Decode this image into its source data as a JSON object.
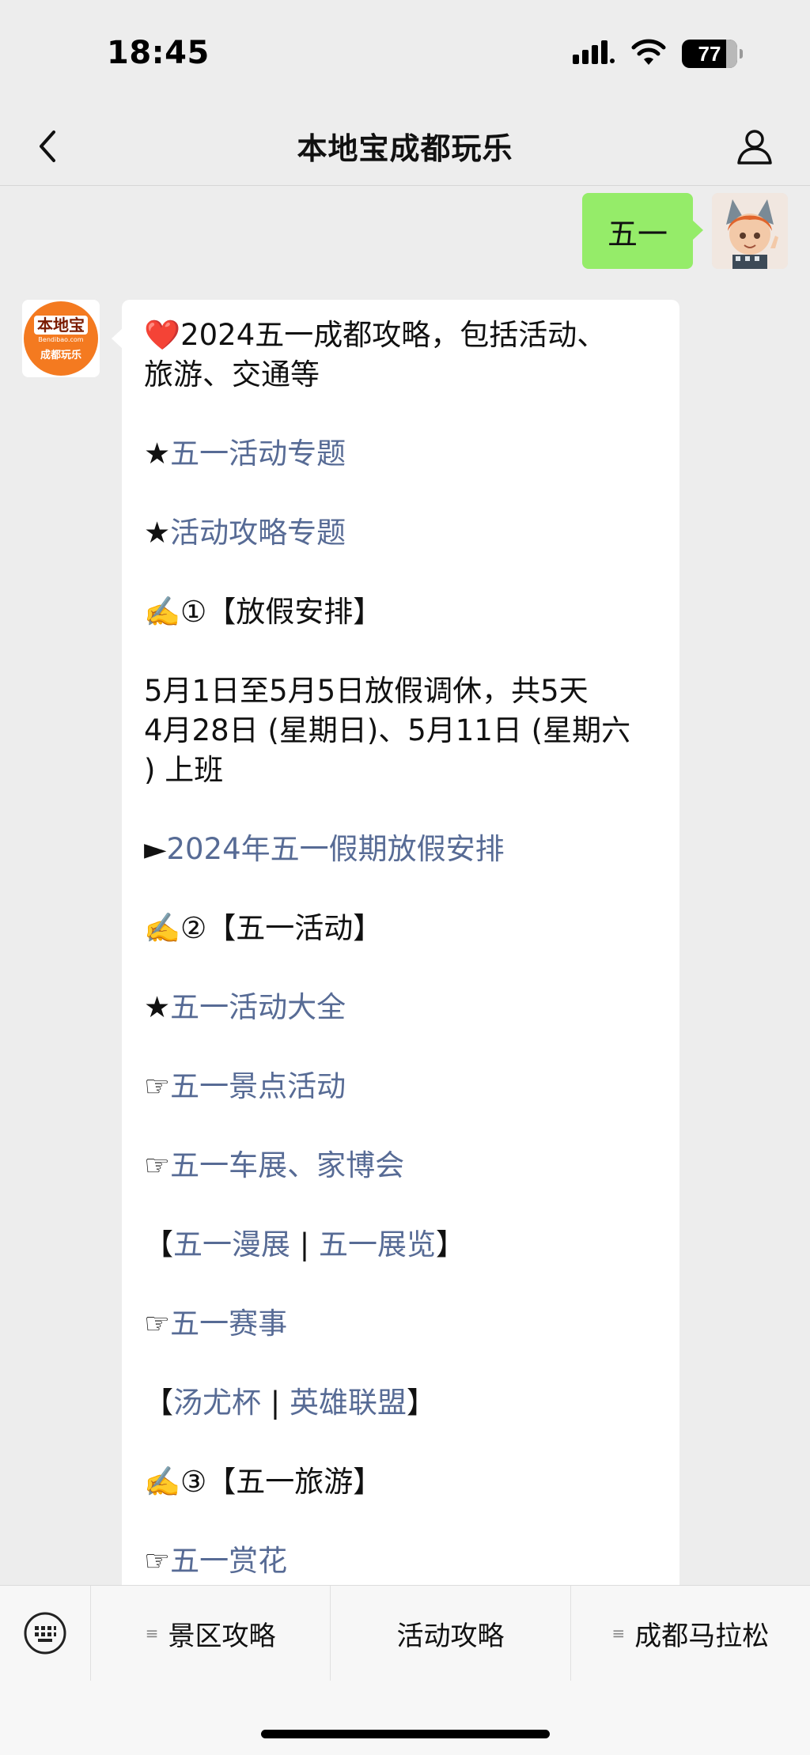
{
  "status_bar": {
    "time": "18:45",
    "battery_level": "77",
    "icons": [
      "signal-icon",
      "wifi-icon",
      "battery-icon"
    ]
  },
  "nav": {
    "title": "本地宝成都玩乐",
    "back_icon": "chevron-left-icon",
    "profile_icon": "person-icon"
  },
  "chat": {
    "sent_message": "五一",
    "bot_avatar": {
      "brand": "本地宝",
      "domain": "Bendibao.com",
      "sub": "成都玩乐"
    },
    "reply": {
      "heading_icon": "❤️",
      "heading_line1": "2024五一成都攻略，包括活动、",
      "heading_line2": "旅游、交通等",
      "p1_prefix": "★",
      "p1_link": "五一活动专题",
      "p2_prefix": "★",
      "p2_link": "活动攻略专题",
      "s1_prefix": "✍️",
      "s1_title": "①【放假安排】",
      "holiday_line1": "5月1日至5月5日放假调休，共5天",
      "holiday_line2": "4月28日 (星期日)、5月11日 (星期六",
      "holiday_line3": ") 上班",
      "p3_prefix": "►",
      "p3_link": "2024年五一假期放假安排",
      "s2_prefix": "✍️",
      "s2_title": "②【五一活动】",
      "p4_prefix": "★",
      "p4_link": "五一活动大全",
      "p5_prefix": "☞",
      "p5_link": "五一景点活动",
      "p6_prefix": "☞",
      "p6_link": "五一车展、家博会",
      "p7_open": "【",
      "p7_link1": "五一漫展",
      "p7_sep": " | ",
      "p7_link2": "五一展览",
      "p7_close": "】",
      "p8_prefix": "☞",
      "p8_link": "五一赛事",
      "p9_open": "【",
      "p9_link1": "汤尤杯",
      "p9_sep": " | ",
      "p9_link2": "英雄联盟",
      "p9_close": "】",
      "s3_prefix": "✍️",
      "s3_title": "③【五一旅游】",
      "p10_prefix": "☞",
      "p10_link": "五一赏花"
    }
  },
  "bottom_menu": {
    "keyboard_icon": "keyboard-icon",
    "items": [
      {
        "label": "景区攻略",
        "has_submenu": true
      },
      {
        "label": "活动攻略",
        "has_submenu": false
      },
      {
        "label": "成都马拉松",
        "has_submenu": true
      }
    ]
  },
  "colors": {
    "background": "#ededed",
    "sent_bubble": "#95ec69",
    "link": "#576b95",
    "brand_orange": "#f47a20"
  }
}
